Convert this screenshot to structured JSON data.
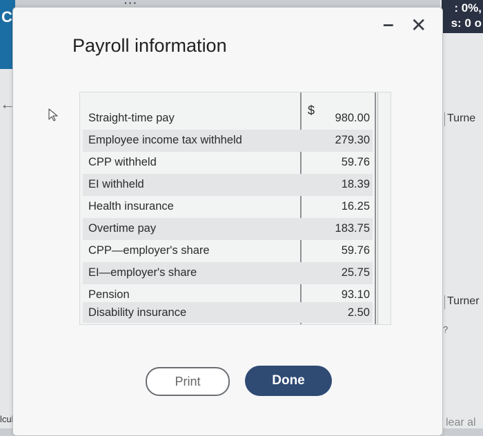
{
  "background": {
    "left_fragment": "CI",
    "left_bottom": "lculate",
    "right_lines": [
      ": 0%,",
      "s: 0 o"
    ],
    "turner_labels": [
      "Turne",
      "Turner"
    ],
    "clear_label": "lear al",
    "question_mark": "?"
  },
  "dialog": {
    "title": "Payroll information",
    "currency_symbol": "$",
    "rows": [
      {
        "label": "Straight-time pay",
        "value": "980.00"
      },
      {
        "label": "Employee income tax withheld",
        "value": "279.30"
      },
      {
        "label": "CPP withheld",
        "value": "59.76"
      },
      {
        "label": "EI withheld",
        "value": "18.39"
      },
      {
        "label": "Health insurance",
        "value": "16.25"
      },
      {
        "label": "Overtime pay",
        "value": "183.75"
      },
      {
        "label": "CPP—employer's share",
        "value": "59.76"
      },
      {
        "label": "EI—employer's share",
        "value": "25.75"
      },
      {
        "label": "Pension",
        "value": "93.10"
      },
      {
        "label": "Disability insurance",
        "value": "2.50"
      }
    ],
    "print_label": "Print",
    "done_label": "Done",
    "minimize_symbol": "–",
    "close_symbol": "✕"
  }
}
